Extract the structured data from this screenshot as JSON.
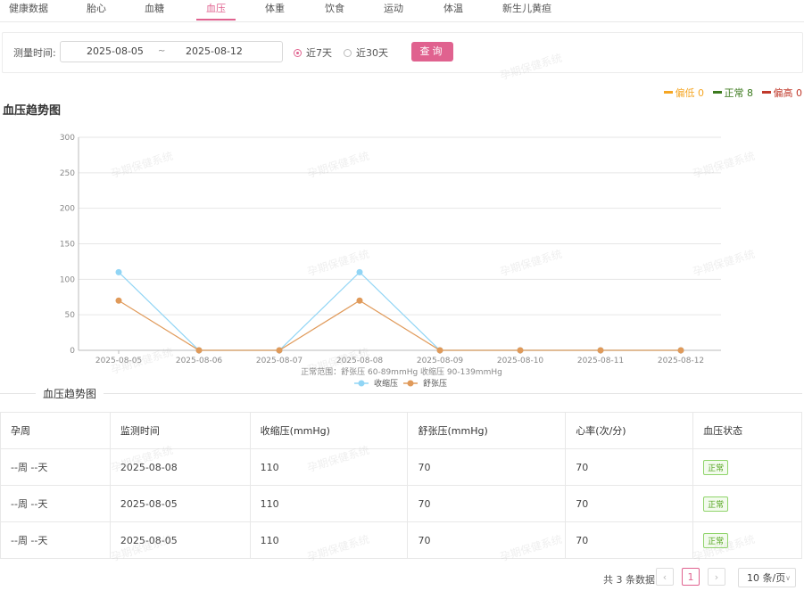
{
  "tabs": [
    {
      "label": "健康数据",
      "active": false
    },
    {
      "label": "胎心",
      "active": false
    },
    {
      "label": "血糖",
      "active": false
    },
    {
      "label": "血压",
      "active": true
    },
    {
      "label": "体重",
      "active": false
    },
    {
      "label": "饮食",
      "active": false
    },
    {
      "label": "运动",
      "active": false
    },
    {
      "label": "体温",
      "active": false
    },
    {
      "label": "新生儿黄疸",
      "active": false
    }
  ],
  "filter": {
    "label": "测量时间:",
    "start_date": "2025-08-05",
    "separator": "~",
    "end_date": "2025-08-12",
    "radio_7": "近7天",
    "radio_30": "近30天",
    "query": "查询"
  },
  "legend_status": [
    {
      "label": "偏低 0",
      "color": "#f5a623"
    },
    {
      "label": "正常 8",
      "color": "#3c7a1e"
    },
    {
      "label": "偏高 0",
      "color": "#c0392b"
    }
  ],
  "chart_title": "血压趋势图",
  "chart_data": {
    "type": "line",
    "x": [
      "2025-08-05",
      "2025-08-06",
      "2025-08-07",
      "2025-08-08",
      "2025-08-09",
      "2025-08-10",
      "2025-08-11",
      "2025-08-12"
    ],
    "series": [
      {
        "name": "收缩压",
        "values": [
          110,
          0,
          0,
          110,
          0,
          0,
          0,
          0
        ],
        "color": "#91d5f5"
      },
      {
        "name": "舒张压",
        "values": [
          70,
          0,
          0,
          70,
          0,
          0,
          0,
          0
        ],
        "color": "#e09a5a"
      }
    ],
    "ylim": [
      0,
      300
    ],
    "yticks": [
      0,
      50,
      100,
      150,
      200,
      250,
      300
    ],
    "xlabel": "正常范围：舒张压 60-89mmHg 收缩压 90-139mmHg",
    "grid": true,
    "legend": "bottom"
  },
  "section_title": "血压趋势图",
  "table": {
    "headers": [
      "孕周",
      "监测时间",
      "收缩压(mmHg)",
      "舒张压(mmHg)",
      "心率(次/分)",
      "血压状态"
    ],
    "rows": [
      [
        "--周 --天",
        "2025-08-08",
        "110",
        "70",
        "70",
        "正常"
      ],
      [
        "--周 --天",
        "2025-08-05",
        "110",
        "70",
        "70",
        "正常"
      ],
      [
        "--周 --天",
        "2025-08-05",
        "110",
        "70",
        "70",
        "正常"
      ]
    ]
  },
  "pagination": {
    "total": "共 3 条数据",
    "prev": "‹",
    "page": "1",
    "next": "›",
    "size": "10 条/页",
    "size_arrow": "∨"
  },
  "watermark": "孕期保健系统"
}
